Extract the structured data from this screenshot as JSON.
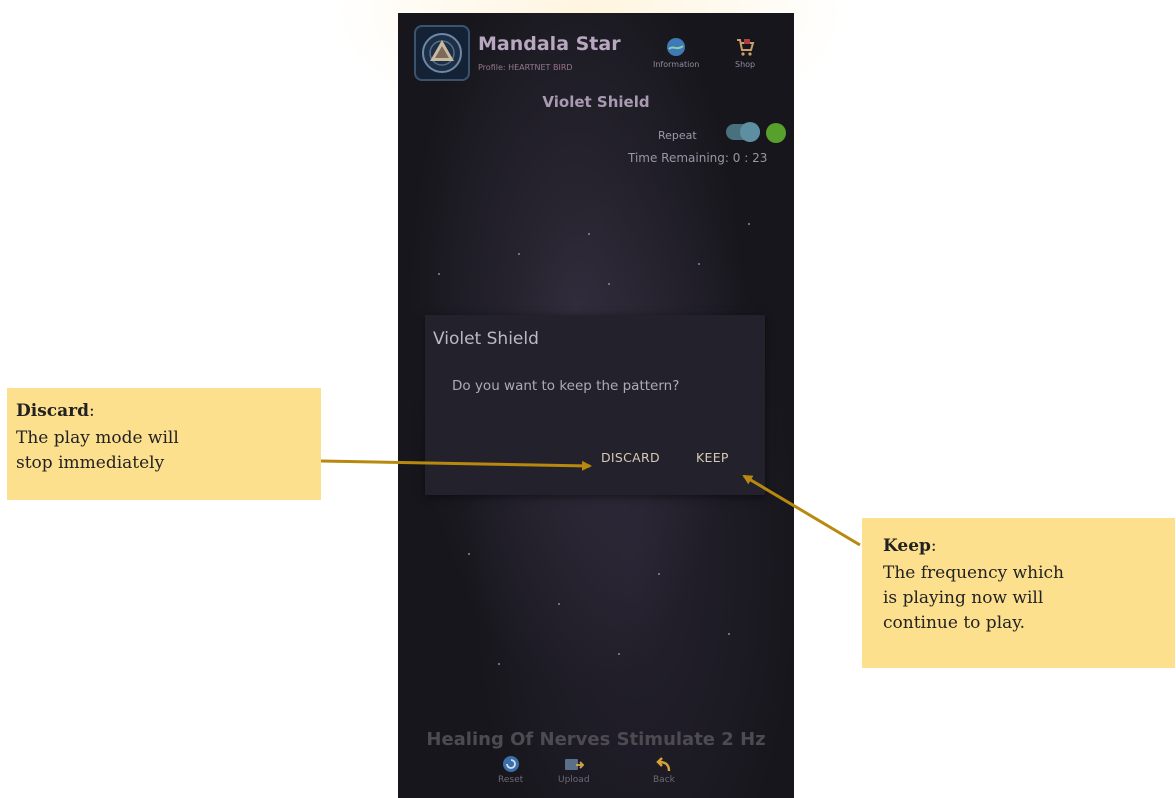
{
  "app": {
    "name": "Mandala Star",
    "profile": "Profile: HEARTNET BIRD",
    "buttons": [
      {
        "label": "Information",
        "icon": "globe-icon"
      },
      {
        "label": "Shop",
        "icon": "cart-icon"
      }
    ]
  },
  "pattern": {
    "title": "Violet Shield",
    "repeat_label": "Repeat",
    "repeat_on": true,
    "time_remaining": "Time Remaining: 0 : 23"
  },
  "dialog": {
    "title": "Violet Shield",
    "message": "Do you want to keep the pattern?",
    "discard_label": "DISCARD",
    "keep_label": "KEEP"
  },
  "bottom": {
    "frequency_title": "Healing Of Nerves Stimulate 2 Hz",
    "nav": [
      {
        "label": "Reset",
        "icon": "reset-icon"
      },
      {
        "label": "Upload",
        "icon": "upload-icon"
      },
      {
        "label": "Back",
        "icon": "back-arrow-icon"
      }
    ]
  },
  "callouts": {
    "discard": {
      "title": "Discard",
      "colon": ":",
      "lines": [
        "The play mode will",
        "stop immediately"
      ]
    },
    "keep": {
      "title": "Keep",
      "colon": ":",
      "lines": [
        "The frequency which",
        "is playing now will",
        "continue to play."
      ]
    }
  },
  "colors": {
    "callout_bg": "#fde08e",
    "arrow": "#b8890e",
    "phone_bg": "#17161c",
    "dialog_bg": "#23222c",
    "toggle_knob": "#5e8ea2",
    "green_dot": "#57a02b"
  }
}
